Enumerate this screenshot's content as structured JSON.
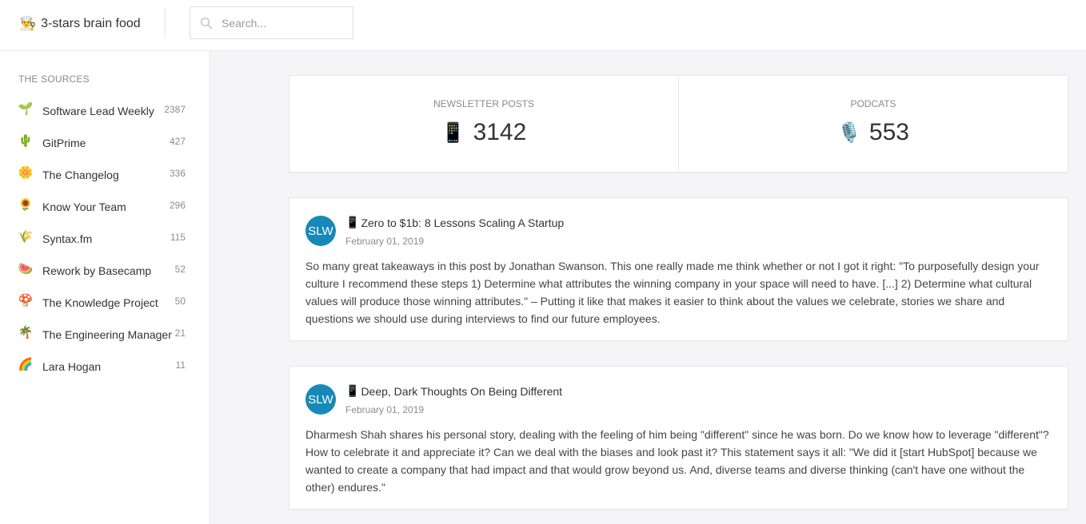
{
  "header": {
    "brand_emoji": "👨‍🍳",
    "brand_title": "3-stars brain food",
    "search_placeholder": "Search...",
    "search_value": ""
  },
  "sidebar": {
    "heading": "THE SOURCES",
    "items": [
      {
        "emoji": "🌱",
        "label": "Software Lead Weekly",
        "count": "2387"
      },
      {
        "emoji": "🌵",
        "label": "GitPrime",
        "count": "427"
      },
      {
        "emoji": "🌼",
        "label": "The Changelog",
        "count": "336"
      },
      {
        "emoji": "🌻",
        "label": "Know Your Team",
        "count": "296"
      },
      {
        "emoji": "🌾",
        "label": "Syntax.fm",
        "count": "115"
      },
      {
        "emoji": "🍉",
        "label": "Rework by Basecamp",
        "count": "52"
      },
      {
        "emoji": "🍄",
        "label": "The Knowledge Project",
        "count": "50"
      },
      {
        "emoji": "🌴",
        "label": "The Engineering Manager",
        "count": "21"
      },
      {
        "emoji": "🌈",
        "label": "Lara Hogan",
        "count": "11"
      }
    ]
  },
  "stats": [
    {
      "title": "NEWSLETTER POSTS",
      "emoji": "📱",
      "value": "3142"
    },
    {
      "title": "PODCATS",
      "emoji": "🎙️",
      "value": "553"
    }
  ],
  "posts": [
    {
      "avatar": "SLW",
      "title_emoji": "📱",
      "title": "Zero to $1b: 8 Lessons Scaling A Startup",
      "date": "February 01, 2019",
      "body": "So many great takeaways in this post by Jonathan Swanson. This one really made me think whether or not I got it right: \"To purposefully design your culture I recommend these steps 1) Determine what attributes the winning company in your space will need to have. [...] 2) Determine what cultural values will produce those winning attributes.\" – Putting it like that makes it easier to think about the values we celebrate, stories we share and questions we should use during interviews to find our future employees."
    },
    {
      "avatar": "SLW",
      "title_emoji": "📱",
      "title": "Deep, Dark Thoughts On Being Different",
      "date": "February 01, 2019",
      "body": "Dharmesh Shah shares his personal story, dealing with the feeling of him being \"different\" since he was born. Do we know how to leverage \"different\"? How to celebrate it and appreciate it? Can we deal with the biases and look past it? This statement says it all: \"We did it [start HubSpot] because we wanted to create a company that had impact and that would grow beyond us. And, diverse teams and diverse thinking (can't have one without the other) endures.\""
    }
  ],
  "colors": {
    "avatar_bg": "#1789b8",
    "page_bg": "#f5f5f7"
  }
}
